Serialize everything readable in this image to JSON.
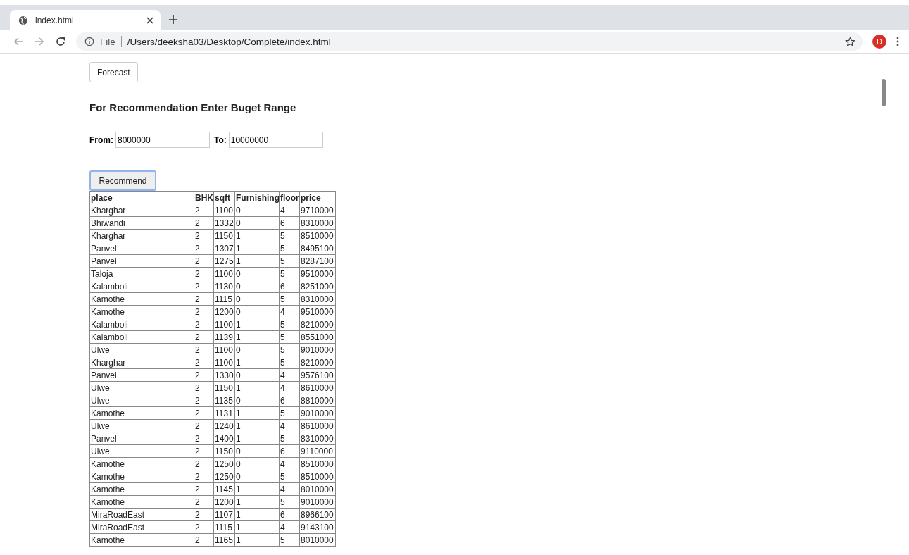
{
  "browser": {
    "tab_title": "index.html",
    "url_scheme": "File",
    "url": "/Users/deeksha03/Desktop/Complete/index.html",
    "profile_initial": "D"
  },
  "page": {
    "forecast_button": "Forecast",
    "heading": "For Recommendation Enter Buget Range",
    "from_label": "From:",
    "from_value": "8000000",
    "to_label": "To:",
    "to_value": "10000000",
    "recommend_button": "Recommend"
  },
  "table": {
    "columns": [
      "place",
      "BHK",
      "sqft",
      "Furnishing",
      "floor",
      "price"
    ],
    "rows": [
      [
        "Kharghar",
        "2",
        "1100",
        "0",
        "4",
        "9710000"
      ],
      [
        "Bhiwandi",
        "2",
        "1332",
        "0",
        "6",
        "8310000"
      ],
      [
        "Kharghar",
        "2",
        "1150",
        "1",
        "5",
        "8510000"
      ],
      [
        "Panvel",
        "2",
        "1307",
        "1",
        "5",
        "8495100"
      ],
      [
        "Panvel",
        "2",
        "1275",
        "1",
        "5",
        "8287100"
      ],
      [
        "Taloja",
        "2",
        "1100",
        "0",
        "5",
        "9510000"
      ],
      [
        "Kalamboli",
        "2",
        "1130",
        "0",
        "6",
        "8251000"
      ],
      [
        "Kamothe",
        "2",
        "1115",
        "0",
        "5",
        "8310000"
      ],
      [
        "Kamothe",
        "2",
        "1200",
        "0",
        "4",
        "9510000"
      ],
      [
        "Kalamboli",
        "2",
        "1100",
        "1",
        "5",
        "8210000"
      ],
      [
        "Kalamboli",
        "2",
        "1139",
        "1",
        "5",
        "8551000"
      ],
      [
        "Ulwe",
        "2",
        "1100",
        "0",
        "5",
        "9010000"
      ],
      [
        "Kharghar",
        "2",
        "1100",
        "1",
        "5",
        "8210000"
      ],
      [
        "Panvel",
        "2",
        "1330",
        "0",
        "4",
        "9576100"
      ],
      [
        "Ulwe",
        "2",
        "1150",
        "1",
        "4",
        "8610000"
      ],
      [
        "Ulwe",
        "2",
        "1135",
        "0",
        "6",
        "8810000"
      ],
      [
        "Kamothe",
        "2",
        "1131",
        "1",
        "5",
        "9010000"
      ],
      [
        "Ulwe",
        "2",
        "1240",
        "1",
        "4",
        "8610000"
      ],
      [
        "Panvel",
        "2",
        "1400",
        "1",
        "5",
        "8310000"
      ],
      [
        "Ulwe",
        "2",
        "1150",
        "0",
        "6",
        "9110000"
      ],
      [
        "Kamothe",
        "2",
        "1250",
        "0",
        "4",
        "8510000"
      ],
      [
        "Kamothe",
        "2",
        "1250",
        "0",
        "5",
        "8510000"
      ],
      [
        "Kamothe",
        "2",
        "1145",
        "1",
        "4",
        "8010000"
      ],
      [
        "Kamothe",
        "2",
        "1200",
        "1",
        "5",
        "9010000"
      ],
      [
        "MiraRoadEast",
        "2",
        "1107",
        "1",
        "6",
        "8966100"
      ],
      [
        "MiraRoadEast",
        "2",
        "1115",
        "1",
        "4",
        "9143100"
      ],
      [
        "Kamothe",
        "2",
        "1165",
        "1",
        "5",
        "8010000"
      ]
    ]
  }
}
